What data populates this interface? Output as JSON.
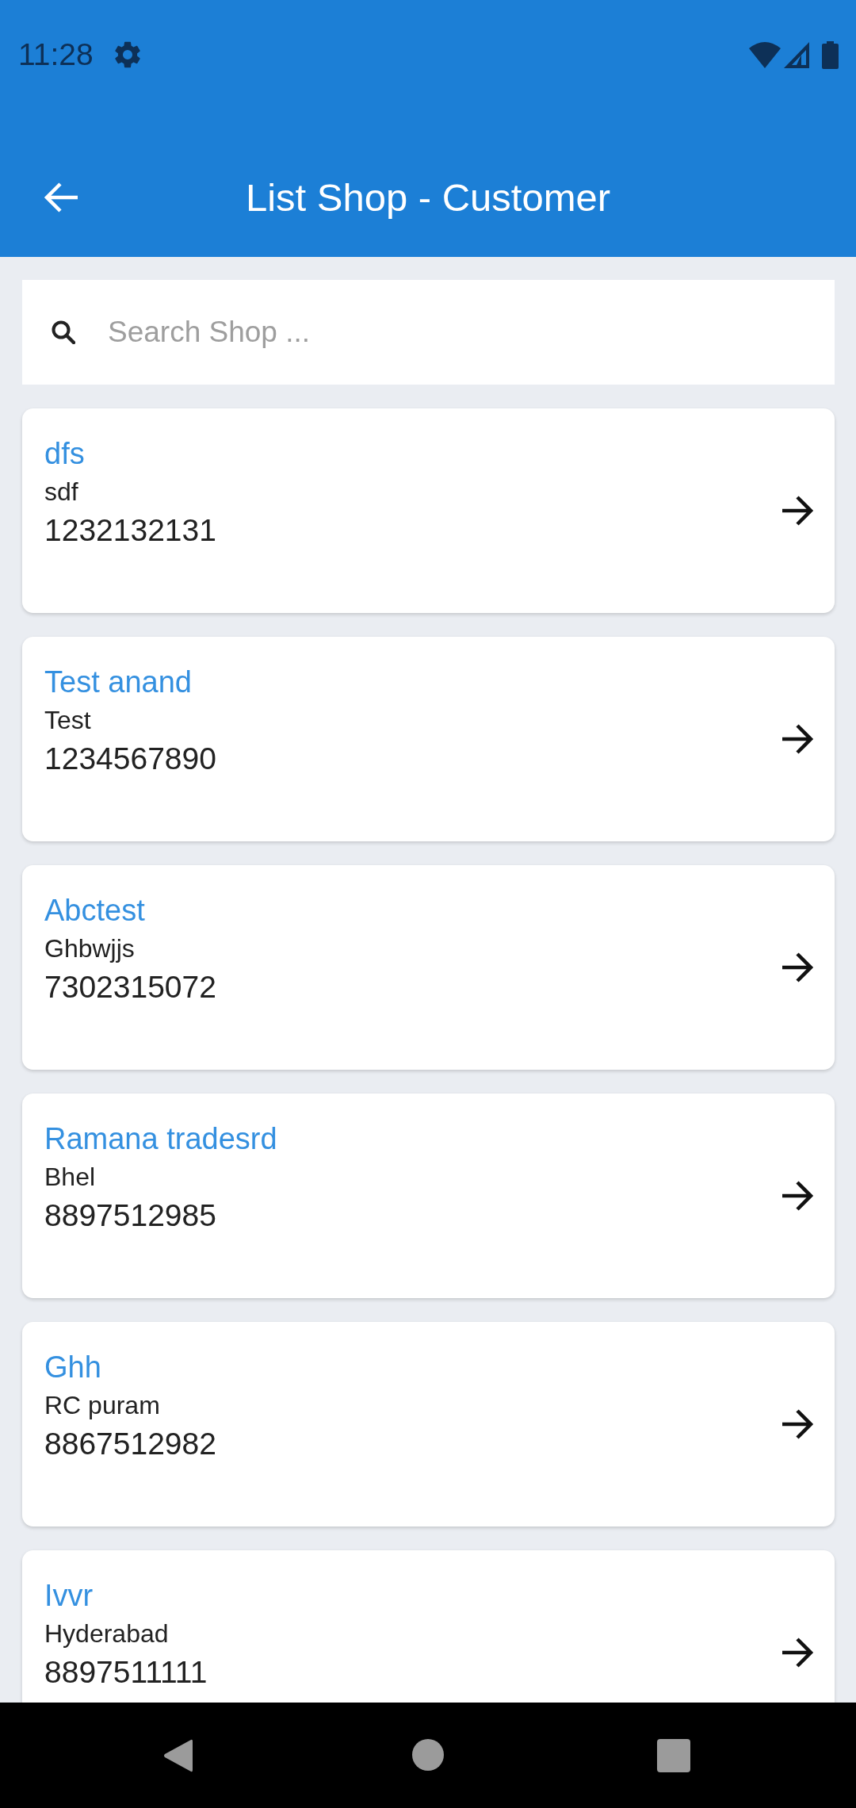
{
  "status_bar": {
    "time": "11:28"
  },
  "app_bar": {
    "title": "List Shop - Customer"
  },
  "search": {
    "placeholder": "Search Shop ..."
  },
  "shops": [
    {
      "name": "dfs",
      "address": "sdf",
      "phone": "1232132131"
    },
    {
      "name": "Test anand",
      "address": "Test",
      "phone": "1234567890"
    },
    {
      "name": "Abctest",
      "address": "Ghbwjjs",
      "phone": "7302315072"
    },
    {
      "name": "Ramana tradesrd",
      "address": "Bhel",
      "phone": "8897512985"
    },
    {
      "name": "Ghh",
      "address": "RC puram",
      "phone": "8867512982"
    },
    {
      "name": "Ivvr",
      "address": "Hyderabad",
      "phone": "8897511111"
    }
  ]
}
